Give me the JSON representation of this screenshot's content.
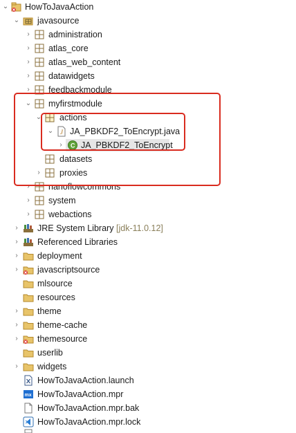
{
  "tree": [
    {
      "id": "r0",
      "label": "HowToJavaAction",
      "icon": "project-icon",
      "twisty": "open"
    },
    {
      "id": "r1",
      "label": "javasource",
      "icon": "source-folder-icon",
      "twisty": "open"
    },
    {
      "id": "r2",
      "label": "administration",
      "icon": "package-icon",
      "twisty": "closed"
    },
    {
      "id": "r3",
      "label": "atlas_core",
      "icon": "package-icon",
      "twisty": "closed"
    },
    {
      "id": "r4",
      "label": "atlas_web_content",
      "icon": "package-icon",
      "twisty": "closed"
    },
    {
      "id": "r5",
      "label": "datawidgets",
      "icon": "package-icon",
      "twisty": "closed"
    },
    {
      "id": "r6",
      "label": "feedbackmodule",
      "icon": "package-icon",
      "twisty": "closed"
    },
    {
      "id": "r7",
      "label": "myfirstmodule",
      "icon": "package-icon",
      "twisty": "open"
    },
    {
      "id": "r8",
      "label": "actions",
      "icon": "package-icon",
      "twisty": "open"
    },
    {
      "id": "r9",
      "label": "JA_PBKDF2_ToEncrypt.java",
      "icon": "java-file-icon",
      "twisty": "open"
    },
    {
      "id": "r10",
      "label": "JA_PBKDF2_ToEncrypt",
      "icon": "java-class-icon",
      "twisty": "closed"
    },
    {
      "id": "r11",
      "label": "datasets",
      "icon": "package-icon",
      "twisty": "none"
    },
    {
      "id": "r12",
      "label": "proxies",
      "icon": "package-icon",
      "twisty": "closed"
    },
    {
      "id": "r13",
      "label": "nanoflowcommons",
      "icon": "package-icon",
      "twisty": "closed"
    },
    {
      "id": "r14",
      "label": "system",
      "icon": "package-icon",
      "twisty": "closed"
    },
    {
      "id": "r15",
      "label": "webactions",
      "icon": "package-icon",
      "twisty": "closed"
    },
    {
      "id": "r16",
      "label": "JRE System Library",
      "extra": "[jdk-11.0.12]",
      "icon": "library-icon",
      "twisty": "closed"
    },
    {
      "id": "r17",
      "label": "Referenced Libraries",
      "icon": "library-icon",
      "twisty": "closed"
    },
    {
      "id": "r18",
      "label": "deployment",
      "icon": "folder-icon",
      "twisty": "closed"
    },
    {
      "id": "r19",
      "label": "javascriptsource",
      "icon": "folder-error-icon",
      "twisty": "closed"
    },
    {
      "id": "r20",
      "label": "mlsource",
      "icon": "folder-icon",
      "twisty": "none"
    },
    {
      "id": "r21",
      "label": "resources",
      "icon": "folder-icon",
      "twisty": "none"
    },
    {
      "id": "r22",
      "label": "theme",
      "icon": "folder-icon",
      "twisty": "closed"
    },
    {
      "id": "r23",
      "label": "theme-cache",
      "icon": "folder-icon",
      "twisty": "closed"
    },
    {
      "id": "r24",
      "label": "themesource",
      "icon": "folder-error-icon",
      "twisty": "closed"
    },
    {
      "id": "r25",
      "label": "userlib",
      "icon": "folder-icon",
      "twisty": "none"
    },
    {
      "id": "r26",
      "label": "widgets",
      "icon": "folder-icon",
      "twisty": "closed"
    },
    {
      "id": "r27",
      "label": "HowToJavaAction.launch",
      "icon": "launch-file-icon",
      "twisty": "none"
    },
    {
      "id": "r28",
      "label": "HowToJavaAction.mpr",
      "icon": "mendix-file-icon",
      "twisty": "none"
    },
    {
      "id": "r29",
      "label": "HowToJavaAction.mpr.bak",
      "icon": "file-icon",
      "twisty": "none"
    },
    {
      "id": "r30",
      "label": "HowToJavaAction.mpr.lock",
      "icon": "vscode-file-icon",
      "twisty": "none"
    }
  ],
  "colors": {
    "highlight": "#d92b1f",
    "selection": "#e6e6e6",
    "folder": "#e8c46a",
    "package": "#8a6f3b"
  }
}
